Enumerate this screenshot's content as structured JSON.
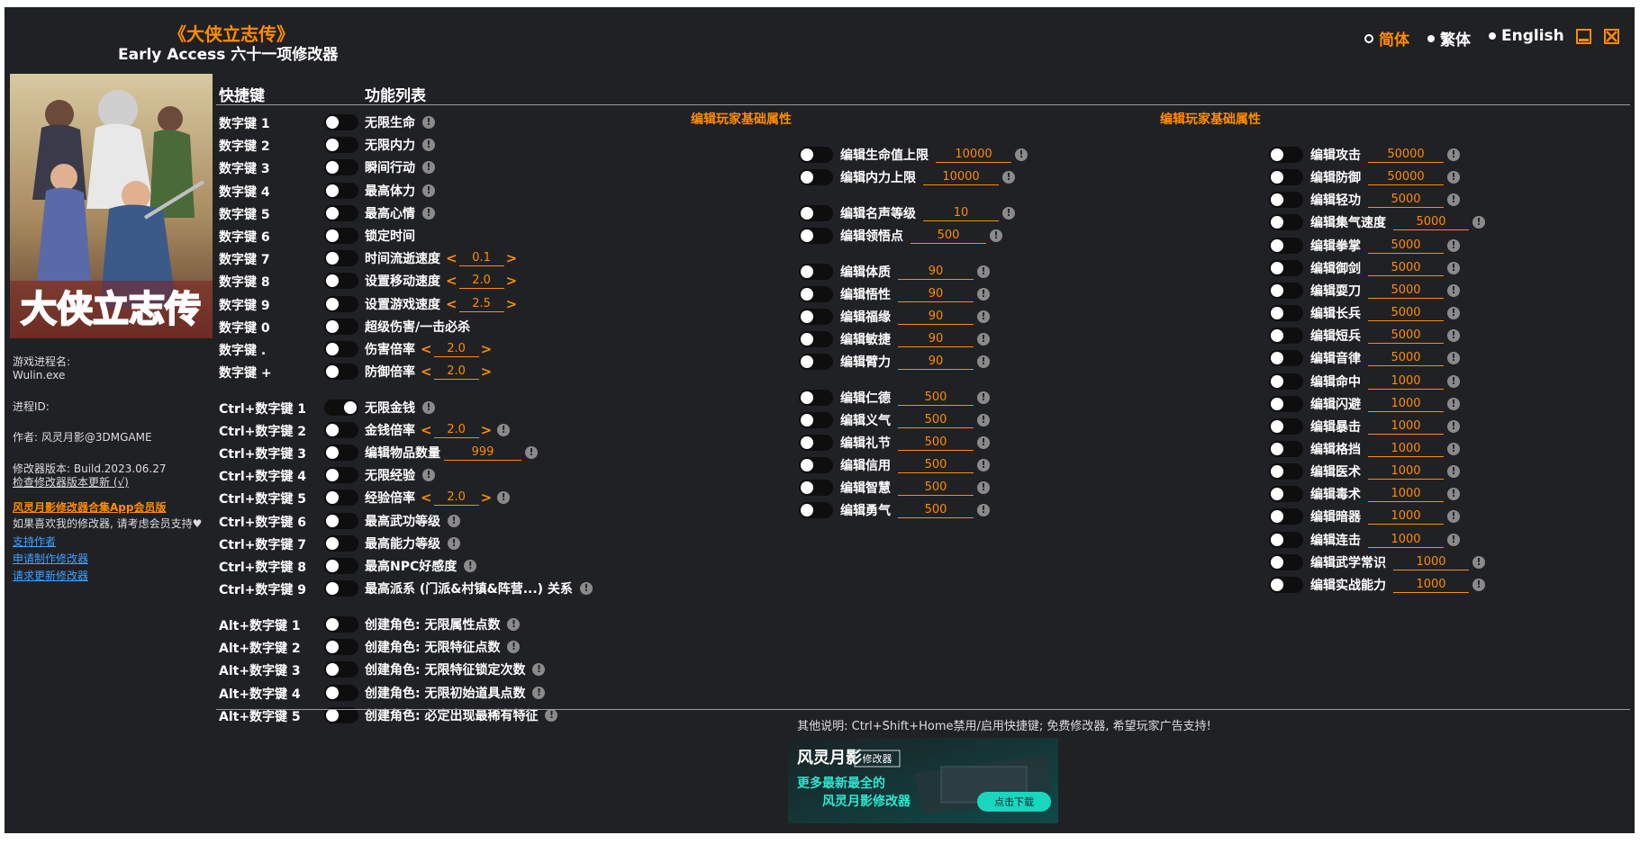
{
  "header": {
    "game_title": "《大侠立志传》",
    "subtitle": "Early Access 六十一项修改器"
  },
  "languages": [
    {
      "label": "简体",
      "selected": true,
      "color": "#ff8c00"
    },
    {
      "label": "繁体",
      "selected": false,
      "color": "#ffffff"
    },
    {
      "label": "English",
      "selected": false,
      "color": "#ffffff"
    }
  ],
  "window_buttons": {
    "minimize": "minimize-icon",
    "close": "close-icon"
  },
  "colors": {
    "accent": "#ff8c00",
    "background": "#202124",
    "link": "#3fa0ff"
  },
  "cover": {
    "title_text": "大侠立志传"
  },
  "left_info": {
    "process_label": "游戏进程名:",
    "process_name": "Wulin.exe",
    "process_id_label": "进程ID:",
    "author": "作者: 风灵月影@3DMGAME",
    "version": "修改器版本: Build.2023.06.27",
    "check_update": "检查修改器版本更新 (√)",
    "app_link": "风灵月影修改器合集App会员版",
    "support_text": "如果喜欢我的修改器, 请考虑会员支持",
    "support_author": "支持作者",
    "request_make": "申请制作修改器",
    "request_update": "请求更新修改器"
  },
  "column_headers": {
    "hotkey": "快捷键",
    "features": "功能列表"
  },
  "main_rows": [
    {
      "hotkey": "数字键 1",
      "name": "无限生命",
      "on": false,
      "info": true
    },
    {
      "hotkey": "数字键 2",
      "name": "无限内力",
      "on": false,
      "info": true
    },
    {
      "hotkey": "数字键 3",
      "name": "瞬间行动",
      "on": false,
      "info": true
    },
    {
      "hotkey": "数字键 4",
      "name": "最高体力",
      "on": false,
      "info": true
    },
    {
      "hotkey": "数字键 5",
      "name": "最高心情",
      "on": false,
      "info": true
    },
    {
      "hotkey": "数字键 6",
      "name": "锁定时间",
      "on": false,
      "info": false
    },
    {
      "hotkey": "数字键 7",
      "name": "时间流逝速度",
      "on": false,
      "info": false,
      "stepper": "0.1"
    },
    {
      "hotkey": "数字键 8",
      "name": "设置移动速度",
      "on": false,
      "info": false,
      "stepper": "2.0"
    },
    {
      "hotkey": "数字键 9",
      "name": "设置游戏速度",
      "on": false,
      "info": false,
      "stepper": "2.5"
    },
    {
      "hotkey": "数字键 0",
      "name": "超级伤害/一击必杀",
      "on": false,
      "info": false
    },
    {
      "hotkey": "数字键 .",
      "name": "伤害倍率",
      "on": false,
      "info": false,
      "stepper": "2.0"
    },
    {
      "hotkey": "数字键 +",
      "name": "防御倍率",
      "on": false,
      "info": false,
      "stepper": "2.0"
    },
    {
      "hotkey": "Ctrl+数字键 1",
      "name": "无限金钱",
      "on": true,
      "info": true
    },
    {
      "hotkey": "Ctrl+数字键 2",
      "name": "金钱倍率",
      "on": false,
      "info": true,
      "stepper": "2.0"
    },
    {
      "hotkey": "Ctrl+数字键 3",
      "name": "编辑物品数量",
      "on": false,
      "info": true,
      "input": "999"
    },
    {
      "hotkey": "Ctrl+数字键 4",
      "name": "无限经验",
      "on": false,
      "info": true
    },
    {
      "hotkey": "Ctrl+数字键 5",
      "name": "经验倍率",
      "on": false,
      "info": true,
      "stepper": "2.0"
    },
    {
      "hotkey": "Ctrl+数字键 6",
      "name": "最高武功等级",
      "on": false,
      "info": true
    },
    {
      "hotkey": "Ctrl+数字键 7",
      "name": "最高能力等级",
      "on": false,
      "info": true
    },
    {
      "hotkey": "Ctrl+数字键 8",
      "name": "最高NPC好感度",
      "on": false,
      "info": true
    },
    {
      "hotkey": "Ctrl+数字键 9",
      "name": "最高派系 (门派&村镇&阵营...) 关系",
      "on": false,
      "info": true
    },
    {
      "hotkey": "Alt+数字键 1",
      "name": "创建角色: 无限属性点数",
      "on": false,
      "info": true
    },
    {
      "hotkey": "Alt+数字键 2",
      "name": "创建角色: 无限特征点数",
      "on": false,
      "info": true
    },
    {
      "hotkey": "Alt+数字键 3",
      "name": "创建角色: 无限特征锁定次数",
      "on": false,
      "info": true
    },
    {
      "hotkey": "Alt+数字键 4",
      "name": "创建角色: 无限初始道具点数",
      "on": false,
      "info": true
    },
    {
      "hotkey": "Alt+数字键 5",
      "name": "创建角色: 必定出现最稀有特征",
      "on": false,
      "info": true
    }
  ],
  "section_titles": {
    "middle": "编辑玩家基础属性",
    "right": "编辑玩家基础属性"
  },
  "middle_rows": [
    {
      "name": "编辑生命值上限",
      "value": "10000"
    },
    {
      "name": "编辑内力上限",
      "value": "10000"
    },
    {
      "name": "编辑名声等级",
      "value": "10"
    },
    {
      "name": "编辑领悟点",
      "value": "500"
    },
    {
      "name": "编辑体质",
      "value": "90"
    },
    {
      "name": "编辑悟性",
      "value": "90"
    },
    {
      "name": "编辑福缘",
      "value": "90"
    },
    {
      "name": "编辑敏捷",
      "value": "90"
    },
    {
      "name": "编辑臂力",
      "value": "90"
    },
    {
      "name": "编辑仁德",
      "value": "500"
    },
    {
      "name": "编辑义气",
      "value": "500"
    },
    {
      "name": "编辑礼节",
      "value": "500"
    },
    {
      "name": "编辑信用",
      "value": "500"
    },
    {
      "name": "编辑智慧",
      "value": "500"
    },
    {
      "name": "编辑勇气",
      "value": "500"
    }
  ],
  "right_rows": [
    {
      "name": "编辑攻击",
      "value": "50000"
    },
    {
      "name": "编辑防御",
      "value": "50000"
    },
    {
      "name": "编辑轻功",
      "value": "5000"
    },
    {
      "name": "编辑集气速度",
      "value": "5000"
    },
    {
      "name": "编辑拳掌",
      "value": "5000"
    },
    {
      "name": "编辑御剑",
      "value": "5000"
    },
    {
      "name": "编辑耍刀",
      "value": "5000"
    },
    {
      "name": "编辑长兵",
      "value": "5000"
    },
    {
      "name": "编辑短兵",
      "value": "5000"
    },
    {
      "name": "编辑音律",
      "value": "5000"
    },
    {
      "name": "编辑命中",
      "value": "1000"
    },
    {
      "name": "编辑闪避",
      "value": "1000"
    },
    {
      "name": "编辑暴击",
      "value": "1000"
    },
    {
      "name": "编辑格挡",
      "value": "1000"
    },
    {
      "name": "编辑医术",
      "value": "1000"
    },
    {
      "name": "编辑毒术",
      "value": "1000"
    },
    {
      "name": "编辑暗器",
      "value": "1000"
    },
    {
      "name": "编辑连击",
      "value": "1000"
    },
    {
      "name": "编辑武学常识",
      "value": "1000"
    },
    {
      "name": "编辑实战能力",
      "value": "1000"
    }
  ],
  "footer": {
    "note": "其他说明: Ctrl+Shift+Home禁用/启用快捷键; 免费修改器, 希望玩家广告支持!"
  },
  "ad": {
    "brand": "风灵月影",
    "tag": "修改器",
    "line1": "更多最新最全的",
    "line2": "风灵月影修改器",
    "button": "点击下载"
  }
}
